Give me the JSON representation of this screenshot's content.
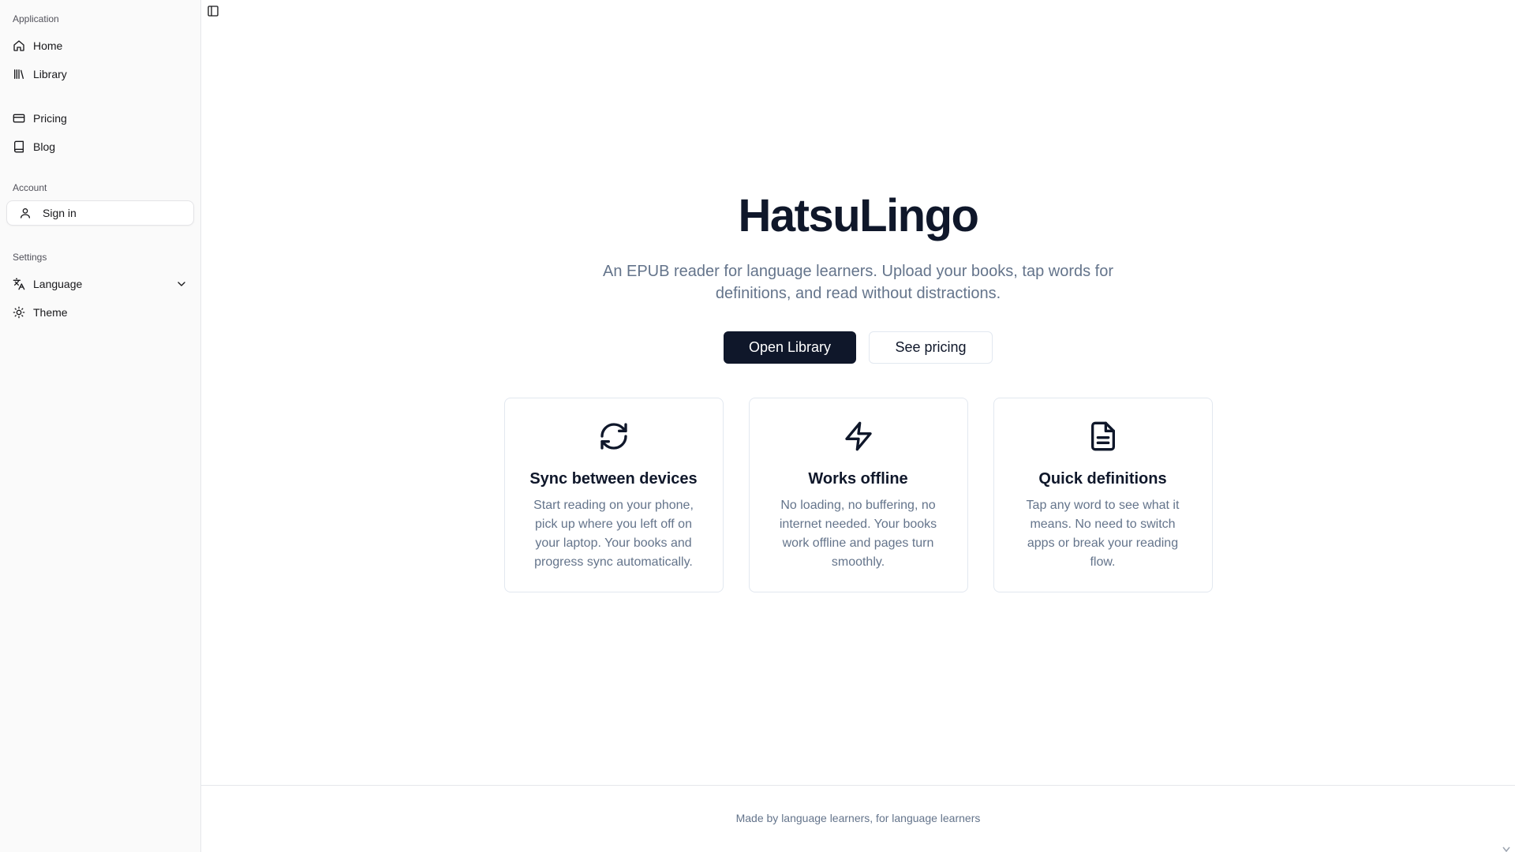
{
  "sidebar": {
    "group_application": "Application",
    "items_app": [
      {
        "label": "Home",
        "icon": "home-icon"
      },
      {
        "label": "Library",
        "icon": "library-icon"
      },
      {
        "label": "Pricing",
        "icon": "credit-card-icon"
      },
      {
        "label": "Blog",
        "icon": "book-icon"
      }
    ],
    "group_account": "Account",
    "sign_in": {
      "label": "Sign in",
      "icon": "user-icon"
    },
    "group_settings": "Settings",
    "language": {
      "label": "Language",
      "icon": "languages-icon"
    },
    "theme": {
      "label": "Theme",
      "icon": "sun-icon"
    }
  },
  "hero": {
    "title": "HatsuLingo",
    "subtitle": "An EPUB reader for language learners. Upload your books, tap words for definitions, and read without distractions.",
    "primary_button": "Open Library",
    "secondary_button": "See pricing"
  },
  "features": [
    {
      "icon": "refresh-icon",
      "title": "Sync between devices",
      "text": "Start reading on your phone, pick up where you left off on your laptop. Your books and progress sync automatically."
    },
    {
      "icon": "zap-icon",
      "title": "Works offline",
      "text": "No loading, no buffering, no internet needed. Your books work offline and pages turn smoothly."
    },
    {
      "icon": "file-text-icon",
      "title": "Quick definitions",
      "text": "Tap any word to see what it means. No need to switch apps or break your reading flow."
    }
  ],
  "footer": {
    "text": "Made by language learners, for language learners"
  },
  "colors": {
    "primary": "#0f172a",
    "muted": "#64748b",
    "border": "#e2e8f0",
    "sidebar_bg": "#fafafa"
  }
}
